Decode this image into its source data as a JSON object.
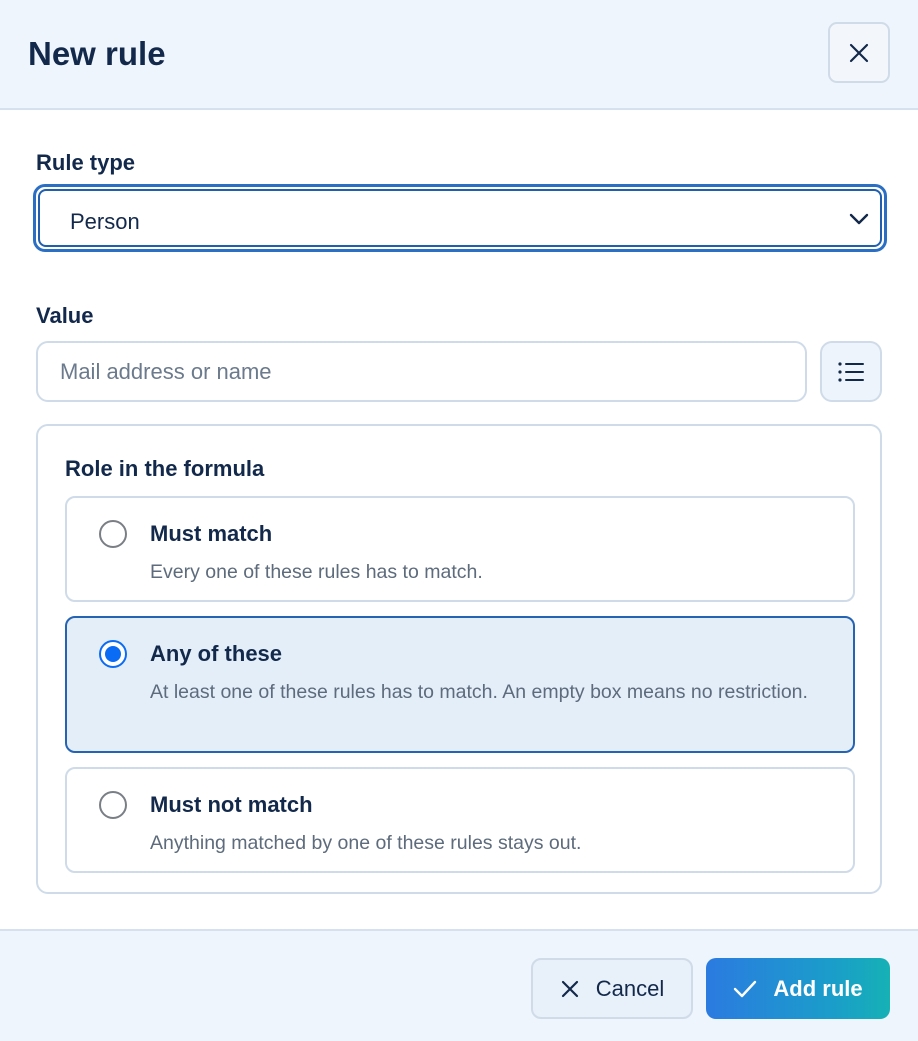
{
  "dialog": {
    "title": "New rule",
    "close_icon": "close-icon"
  },
  "rule_type": {
    "label": "Rule type",
    "selected": "Person",
    "chevron_icon": "chevron-down-icon"
  },
  "value": {
    "label": "Value",
    "placeholder": "Mail address or name",
    "current": "",
    "list_icon": "list-icon"
  },
  "role": {
    "title": "Role in the formula",
    "options": [
      {
        "title": "Must match",
        "description": "Every one of these rules has to match.",
        "checked": false
      },
      {
        "title": "Any of these",
        "description": "At least one of these rules has to match. An empty box means no restriction.",
        "checked": true
      },
      {
        "title": "Must not match",
        "description": "Anything matched by one of these rules stays out.",
        "checked": false
      }
    ]
  },
  "footer": {
    "cancel_label": "Cancel",
    "add_label": "Add rule",
    "cancel_icon": "x-icon",
    "add_icon": "check-icon"
  },
  "colors": {
    "accent": "#0a6cf5",
    "header_bg": "#eff5fc",
    "selected_bg": "#e4eef9",
    "text": "#13294b"
  }
}
